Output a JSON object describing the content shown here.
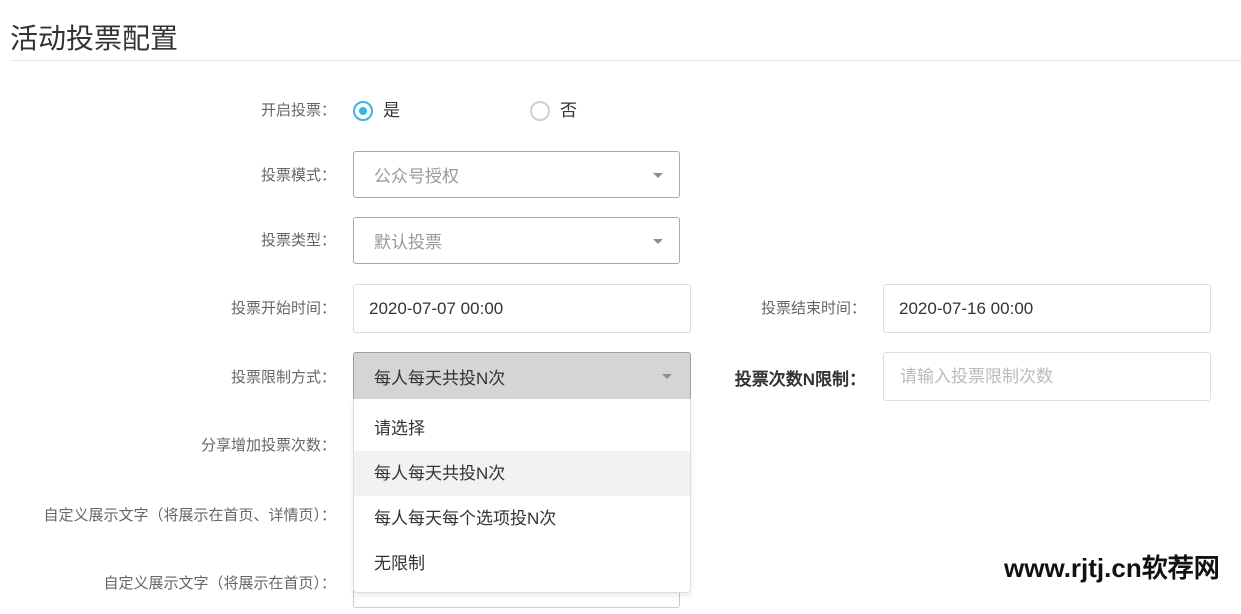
{
  "page": {
    "title": "活动投票配置"
  },
  "form": {
    "enable_vote": {
      "label": "开启投票：",
      "options": [
        {
          "label": "是",
          "checked": true
        },
        {
          "label": "否",
          "checked": false
        }
      ]
    },
    "vote_mode": {
      "label": "投票模式：",
      "value": "公众号授权"
    },
    "vote_type": {
      "label": "投票类型：",
      "value": "默认投票"
    },
    "start_time": {
      "label": "投票开始时间：",
      "value": "2020-07-07 00:00"
    },
    "end_time": {
      "label": "投票结束时间：",
      "value": "2020-07-16 00:00"
    },
    "limit_method": {
      "label": "投票限制方式：",
      "value": "每人每天共投N次",
      "dropdown_open": true,
      "highlighted_index": 1,
      "options": [
        "请选择",
        "每人每天共投N次",
        "每人每天每个选项投N次",
        "无限制"
      ]
    },
    "limit_count": {
      "label": "投票次数N限制：",
      "placeholder": "请输入投票限制次数",
      "value": ""
    },
    "share_bonus": {
      "label": "分享增加投票次数："
    },
    "custom_text_home_detail": {
      "label": "自定义展示文字（将展示在首页、详情页）："
    },
    "custom_text_home": {
      "label": "自定义展示文字（将展示在首页）：",
      "value": ""
    }
  },
  "watermark": {
    "text": "www.rjtj.cn软荐网"
  },
  "icons": {
    "select_caret": "caret-down-icon",
    "radio": "radio-icon"
  },
  "colors": {
    "accent": "#3bb4e5",
    "label": "#666666",
    "text": "#333333",
    "muted": "#999999",
    "placeholder": "#bbbbbb",
    "active_select_bg": "#d5d5d5",
    "highlight_bg": "#f2f2f2"
  }
}
